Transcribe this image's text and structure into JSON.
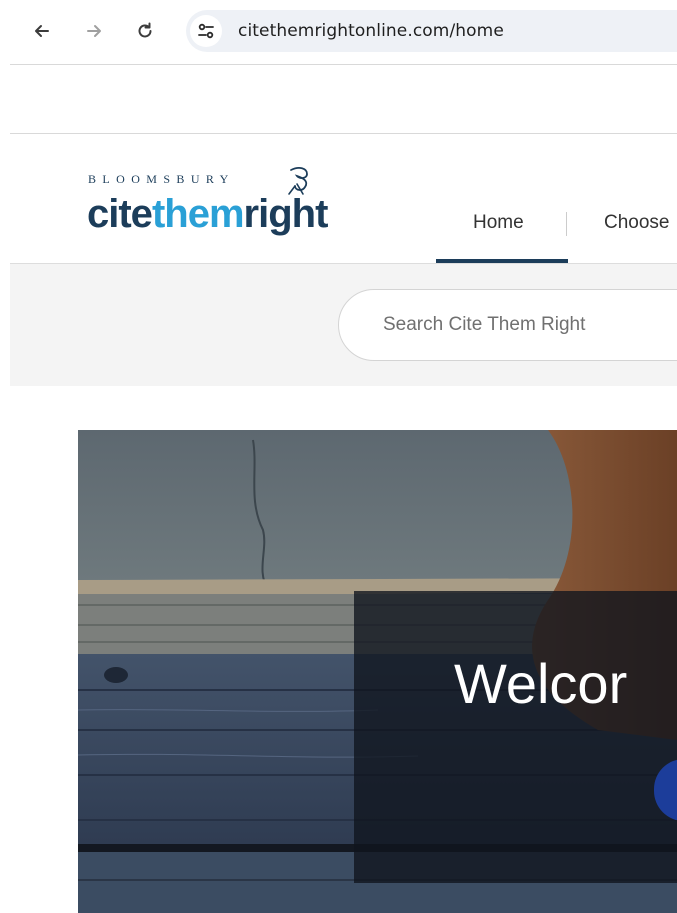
{
  "browser": {
    "url": "citethemrightonline.com/home",
    "back_icon": "arrow-left-icon",
    "forward_icon": "arrow-right-icon",
    "reload_icon": "reload-icon",
    "site_info_icon": "tune-icon"
  },
  "header": {
    "logo_top": "BLOOMSBURY",
    "logo_cite": "cite",
    "logo_them": "them",
    "logo_right": "right",
    "nav": [
      {
        "label": "Home",
        "active": true
      },
      {
        "label": "Choose"
      }
    ]
  },
  "search": {
    "placeholder": "Search Cite Them Right"
  },
  "hero": {
    "title": "Welcor"
  },
  "colors": {
    "brand_navy": "#1c3d5a",
    "brand_blue": "#2aa0d6",
    "button_blue": "#1c3d9a"
  }
}
